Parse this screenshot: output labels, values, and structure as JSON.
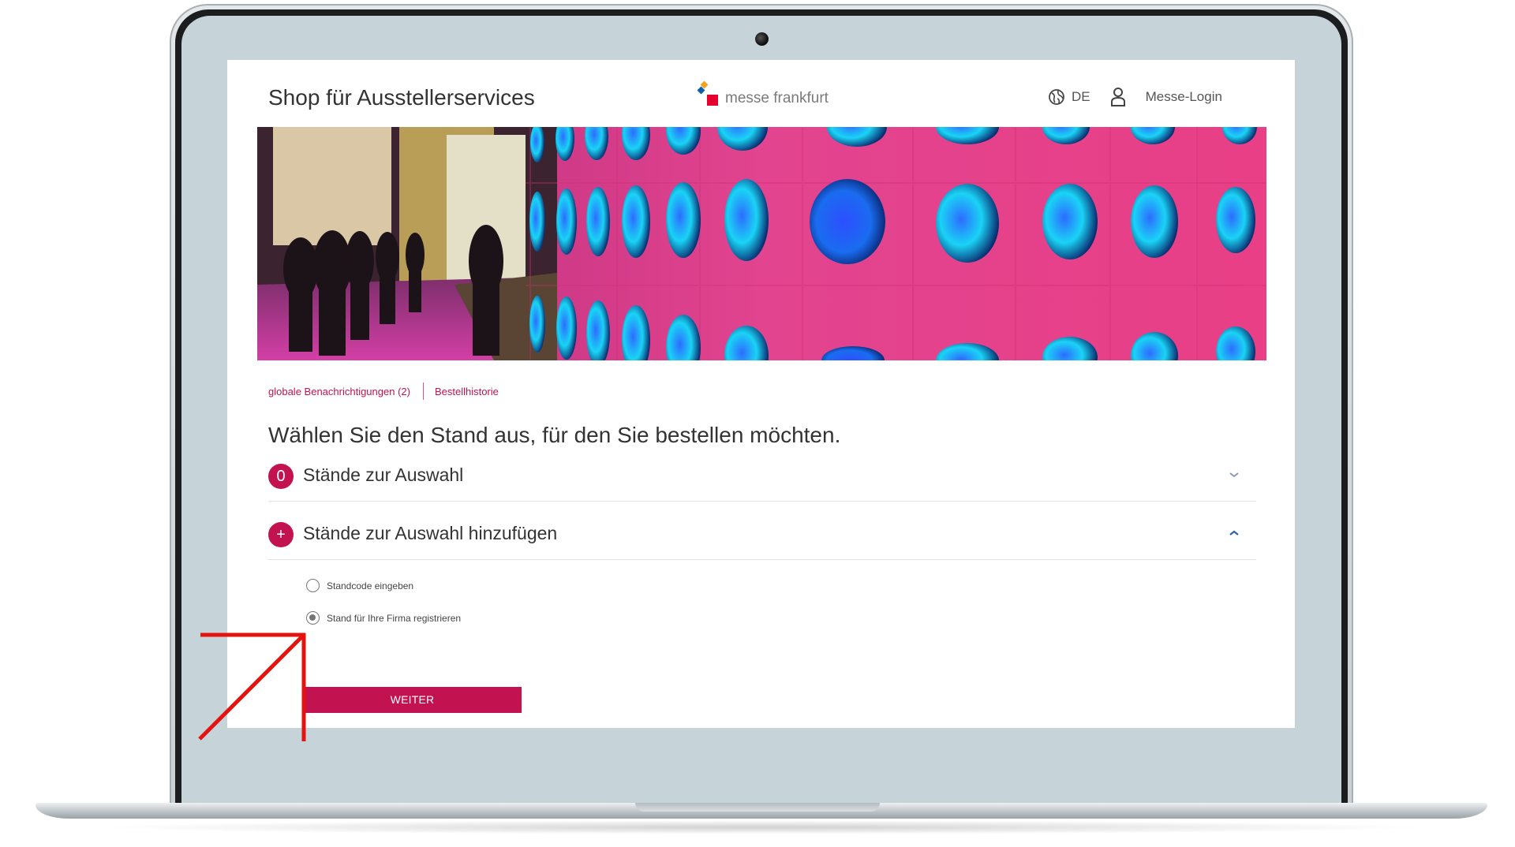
{
  "header": {
    "site_title": "Shop für Ausstellerservices",
    "logo_text": "messe frankfurt",
    "language": "DE",
    "login_label": "Messe-Login"
  },
  "subnav": {
    "items": [
      "globale Benachrichtigungen (2)",
      "Bestellhistorie"
    ]
  },
  "main": {
    "headline": "Wählen Sie den Stand aus, für den Sie bestellen möchten.",
    "accordions": [
      {
        "badge": "0",
        "title": "Stände zur Auswahl",
        "expanded": false
      },
      {
        "badge": "+",
        "title": "Stände zur Auswahl hinzufügen",
        "expanded": true
      }
    ],
    "radio_options": [
      {
        "label": "Standcode eingeben",
        "selected": false
      },
      {
        "label": "Stand für Ihre Firma registrieren",
        "selected": true
      }
    ],
    "submit_label": "WEITER"
  },
  "colors": {
    "accent": "#c2124f",
    "annotation_arrow": "#e3140f",
    "hero_pink": "#e2448f",
    "hero_cyan": "#1ad3f5"
  },
  "icons": [
    "globe-icon",
    "user-icon",
    "chevron-down-icon",
    "chevron-up-icon",
    "annotation-arrow-icon"
  ]
}
